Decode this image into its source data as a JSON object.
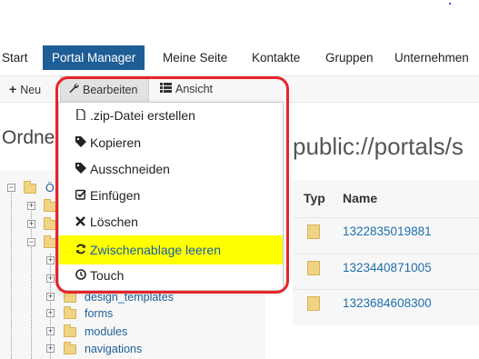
{
  "nav": {
    "items": [
      "Start",
      "Portal Manager",
      "Meine Seite",
      "Kontakte",
      "Gruppen",
      "Unternehmen"
    ],
    "active": "Portal Manager"
  },
  "toolbar": {
    "new_label": "Neu",
    "edit_label": "Bearbeiten",
    "view_label": "Ansicht"
  },
  "content": {
    "heading": "Ordne",
    "path": "public://portals/s"
  },
  "tree": {
    "root_label": "Ö",
    "items": [
      "design_templates",
      "forms",
      "modules",
      "navigations"
    ]
  },
  "table": {
    "col_type": "Typ",
    "col_name": "Name",
    "rows": [
      "1322835019881",
      "1323440871005",
      "1323684608300"
    ]
  },
  "menu": {
    "items": [
      {
        "label": ".zip-Datei erstellen",
        "icon": "file-icon"
      },
      {
        "label": "Kopieren",
        "icon": "tag-icon"
      },
      {
        "label": "Ausschneiden",
        "icon": "tag-icon"
      },
      {
        "label": "Einfügen",
        "icon": "check-square-icon"
      },
      {
        "label": "Löschen",
        "icon": "x-icon"
      },
      {
        "label": "Zwischenablage leeren",
        "icon": "refresh-icon"
      },
      {
        "label": "Touch",
        "icon": "clock-icon"
      }
    ],
    "highlight_color": "#ffff00"
  },
  "colors": {
    "nav_active": "#1e5d95",
    "link": "#1f6fa8",
    "outline": "#e8232a"
  }
}
